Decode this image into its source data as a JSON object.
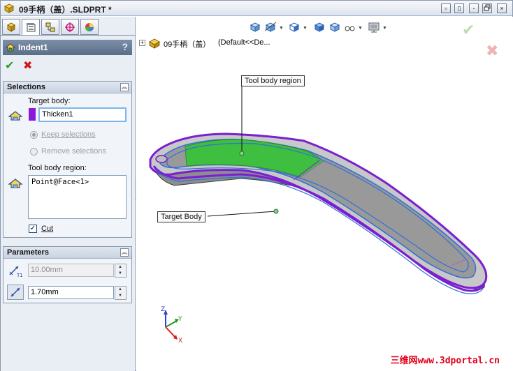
{
  "window": {
    "title": "09手柄（盖）.SLDPRT *",
    "buttons": {
      "restore": "▫",
      "tile": "▯",
      "minimize": "-",
      "close": "×"
    }
  },
  "panel": {
    "tabs": [
      "feature-manager-icon",
      "property-manager-icon",
      "configuration-manager-icon",
      "dimxpert-icon",
      "display-manager-icon"
    ],
    "property_manager": {
      "title": "Indent1",
      "help": "?",
      "ok": "✔",
      "cancel": "✖"
    },
    "selections": {
      "title": "Selections",
      "target_body_label": "Target body:",
      "target_body_value": "Thicken1",
      "target_body_color": "#8a1ad8",
      "keep_label": "Keep selections",
      "remove_label": "Remove selections",
      "tool_region_label": "Tool body region:",
      "tool_region_value": "Point@Face<1>",
      "cut_label": "Cut",
      "cut_checked": "✓"
    },
    "parameters": {
      "title": "Parameters",
      "thickness_value": "10.00mm",
      "clearance_value": "1.70mm"
    }
  },
  "graphics": {
    "tree": {
      "expander": "+",
      "part_name": "09手柄（盖）",
      "config": "(Default<<De..."
    },
    "callouts": {
      "tool_region": "Tool body region",
      "target_body": "Target Body"
    },
    "triad": {
      "x": "X",
      "y": "Y",
      "z": "Z"
    },
    "confirm": {
      "ok": "✔",
      "cancel": "✖"
    },
    "colors": {
      "shell_outline": "#7a1fd1",
      "tool_region": "#3fbf3f",
      "body_gray": "#8d8d8d",
      "edge_blue": "#2f6fd8"
    }
  },
  "watermark": "三维网www.3dportal.cn"
}
